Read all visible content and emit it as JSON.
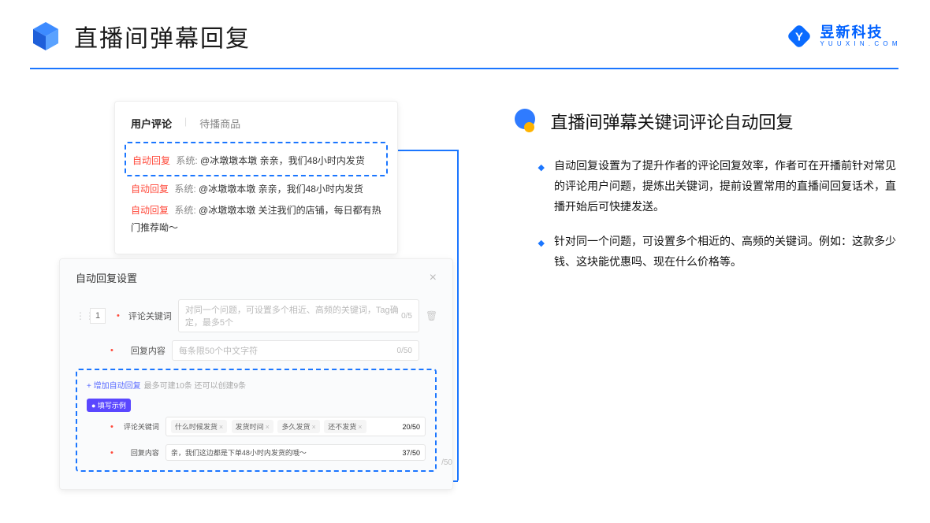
{
  "header": {
    "title": "直播间弹幕回复",
    "logo_cn": "昱新科技",
    "logo_en": "Y U U X I N . C O M"
  },
  "shot": {
    "tabs": {
      "active": "用户评论",
      "inactive": "待播商品"
    },
    "msg1": {
      "tag": "自动回复",
      "sys": "系统:",
      "body": "@冰墩墩本墩 亲亲，我们48小时内发货"
    },
    "msg2": {
      "tag": "自动回复",
      "sys": "系统:",
      "body": "@冰墩墩本墩 亲亲，我们48小时内发货"
    },
    "msg3": {
      "tag": "自动回复",
      "sys": "系统:",
      "body": "@冰墩墩本墩 关注我们的店铺，每日都有热门推荐呦～"
    },
    "modal_title": "自动回复设置",
    "row_num": "1",
    "label_keyword": "评论关键词",
    "label_content": "回复内容",
    "placeholder_keyword": "对同一个问题，可设置多个相近、高频的关键词，Tag确定，最多5个",
    "counter_keyword": "0/5",
    "placeholder_content": "每条限50个中文字符",
    "counter_content": "0/50",
    "add_auto": "+ 增加自动回复",
    "add_hint": "最多可建10条 还可以创建9条",
    "example_pill": "● 填写示例",
    "ex_kw_label": "评论关键词",
    "ex_kw_tags": [
      "什么时候发货",
      "发货时间",
      "多久发货",
      "还不发货"
    ],
    "ex_kw_counter": "20/50",
    "ex_ct_label": "回复内容",
    "ex_ct_text": "亲，我们这边都是下单48小时内发货的哦～",
    "ex_ct_counter": "37/50",
    "outer_counter": "/50"
  },
  "right": {
    "title": "直播间弹幕关键词评论自动回复",
    "bullet1": "自动回复设置为了提升作者的评论回复效率，作者可在开播前针对常见的评论用户问题，提炼出关键词，提前设置常用的直播间回复话术，直播开始后可快捷发送。",
    "bullet2": "针对同一个问题，可设置多个相近的、高频的关键词。例如：这款多少钱、这块能优惠吗、现在什么价格等。"
  }
}
